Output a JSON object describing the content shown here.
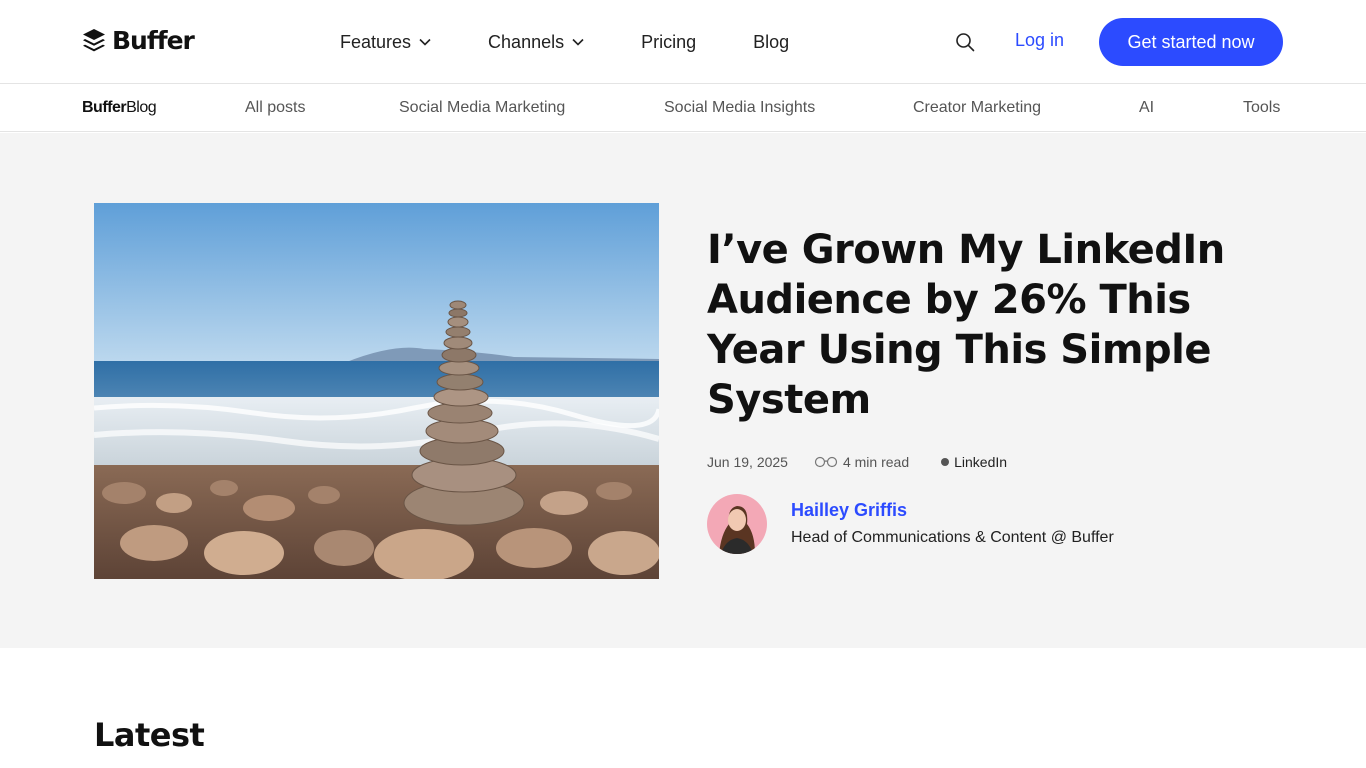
{
  "brand": {
    "name": "Buffer"
  },
  "nav": {
    "items": [
      {
        "label": "Features",
        "dropdown": true
      },
      {
        "label": "Channels",
        "dropdown": true
      },
      {
        "label": "Pricing",
        "dropdown": false
      },
      {
        "label": "Blog",
        "dropdown": false
      }
    ],
    "login": "Log in",
    "cta": "Get started now"
  },
  "subnav": {
    "logo_bold": "Buffer",
    "logo_rest": "Blog",
    "items": [
      "All posts",
      "Social Media Marketing",
      "Social Media Insights",
      "Creator Marketing",
      "AI",
      "Tools"
    ]
  },
  "article": {
    "title": "I’ve Grown My LinkedIn Audience by 26% This Year Using This Simple System",
    "date": "Jun 19, 2025",
    "read_time": "4 min read",
    "tag": "LinkedIn",
    "author": {
      "name": "Hailley Griffis",
      "role": "Head of Communications & Content @ Buffer"
    }
  },
  "sections": {
    "latest": "Latest"
  },
  "colors": {
    "accent": "#2c4bff",
    "hero_bg": "#f4f4f4"
  }
}
